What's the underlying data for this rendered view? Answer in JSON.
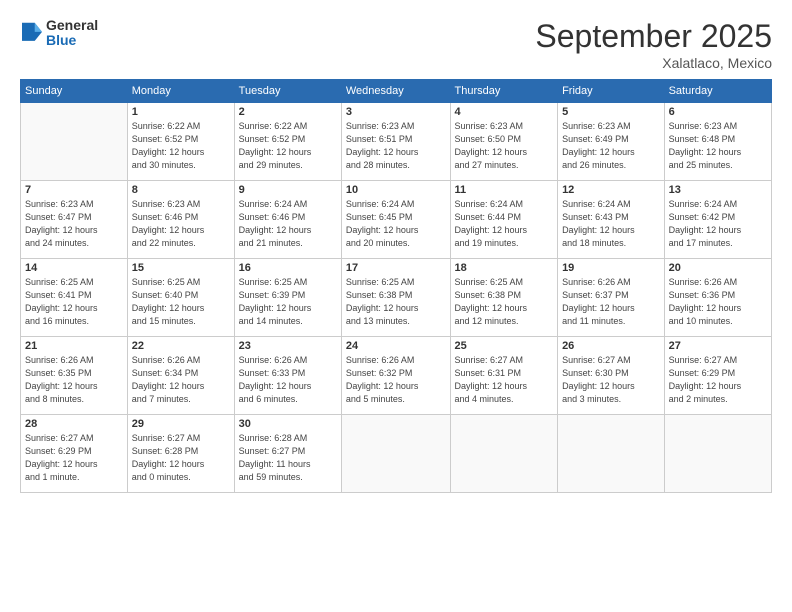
{
  "header": {
    "logo_general": "General",
    "logo_blue": "Blue",
    "month_title": "September 2025",
    "location": "Xalatlaco, Mexico"
  },
  "weekdays": [
    "Sunday",
    "Monday",
    "Tuesday",
    "Wednesday",
    "Thursday",
    "Friday",
    "Saturday"
  ],
  "weeks": [
    [
      {
        "day": "",
        "detail": ""
      },
      {
        "day": "1",
        "detail": "Sunrise: 6:22 AM\nSunset: 6:52 PM\nDaylight: 12 hours\nand 30 minutes."
      },
      {
        "day": "2",
        "detail": "Sunrise: 6:22 AM\nSunset: 6:52 PM\nDaylight: 12 hours\nand 29 minutes."
      },
      {
        "day": "3",
        "detail": "Sunrise: 6:23 AM\nSunset: 6:51 PM\nDaylight: 12 hours\nand 28 minutes."
      },
      {
        "day": "4",
        "detail": "Sunrise: 6:23 AM\nSunset: 6:50 PM\nDaylight: 12 hours\nand 27 minutes."
      },
      {
        "day": "5",
        "detail": "Sunrise: 6:23 AM\nSunset: 6:49 PM\nDaylight: 12 hours\nand 26 minutes."
      },
      {
        "day": "6",
        "detail": "Sunrise: 6:23 AM\nSunset: 6:48 PM\nDaylight: 12 hours\nand 25 minutes."
      }
    ],
    [
      {
        "day": "7",
        "detail": "Sunrise: 6:23 AM\nSunset: 6:47 PM\nDaylight: 12 hours\nand 24 minutes."
      },
      {
        "day": "8",
        "detail": "Sunrise: 6:23 AM\nSunset: 6:46 PM\nDaylight: 12 hours\nand 22 minutes."
      },
      {
        "day": "9",
        "detail": "Sunrise: 6:24 AM\nSunset: 6:46 PM\nDaylight: 12 hours\nand 21 minutes."
      },
      {
        "day": "10",
        "detail": "Sunrise: 6:24 AM\nSunset: 6:45 PM\nDaylight: 12 hours\nand 20 minutes."
      },
      {
        "day": "11",
        "detail": "Sunrise: 6:24 AM\nSunset: 6:44 PM\nDaylight: 12 hours\nand 19 minutes."
      },
      {
        "day": "12",
        "detail": "Sunrise: 6:24 AM\nSunset: 6:43 PM\nDaylight: 12 hours\nand 18 minutes."
      },
      {
        "day": "13",
        "detail": "Sunrise: 6:24 AM\nSunset: 6:42 PM\nDaylight: 12 hours\nand 17 minutes."
      }
    ],
    [
      {
        "day": "14",
        "detail": "Sunrise: 6:25 AM\nSunset: 6:41 PM\nDaylight: 12 hours\nand 16 minutes."
      },
      {
        "day": "15",
        "detail": "Sunrise: 6:25 AM\nSunset: 6:40 PM\nDaylight: 12 hours\nand 15 minutes."
      },
      {
        "day": "16",
        "detail": "Sunrise: 6:25 AM\nSunset: 6:39 PM\nDaylight: 12 hours\nand 14 minutes."
      },
      {
        "day": "17",
        "detail": "Sunrise: 6:25 AM\nSunset: 6:38 PM\nDaylight: 12 hours\nand 13 minutes."
      },
      {
        "day": "18",
        "detail": "Sunrise: 6:25 AM\nSunset: 6:38 PM\nDaylight: 12 hours\nand 12 minutes."
      },
      {
        "day": "19",
        "detail": "Sunrise: 6:26 AM\nSunset: 6:37 PM\nDaylight: 12 hours\nand 11 minutes."
      },
      {
        "day": "20",
        "detail": "Sunrise: 6:26 AM\nSunset: 6:36 PM\nDaylight: 12 hours\nand 10 minutes."
      }
    ],
    [
      {
        "day": "21",
        "detail": "Sunrise: 6:26 AM\nSunset: 6:35 PM\nDaylight: 12 hours\nand 8 minutes."
      },
      {
        "day": "22",
        "detail": "Sunrise: 6:26 AM\nSunset: 6:34 PM\nDaylight: 12 hours\nand 7 minutes."
      },
      {
        "day": "23",
        "detail": "Sunrise: 6:26 AM\nSunset: 6:33 PM\nDaylight: 12 hours\nand 6 minutes."
      },
      {
        "day": "24",
        "detail": "Sunrise: 6:26 AM\nSunset: 6:32 PM\nDaylight: 12 hours\nand 5 minutes."
      },
      {
        "day": "25",
        "detail": "Sunrise: 6:27 AM\nSunset: 6:31 PM\nDaylight: 12 hours\nand 4 minutes."
      },
      {
        "day": "26",
        "detail": "Sunrise: 6:27 AM\nSunset: 6:30 PM\nDaylight: 12 hours\nand 3 minutes."
      },
      {
        "day": "27",
        "detail": "Sunrise: 6:27 AM\nSunset: 6:29 PM\nDaylight: 12 hours\nand 2 minutes."
      }
    ],
    [
      {
        "day": "28",
        "detail": "Sunrise: 6:27 AM\nSunset: 6:29 PM\nDaylight: 12 hours\nand 1 minute."
      },
      {
        "day": "29",
        "detail": "Sunrise: 6:27 AM\nSunset: 6:28 PM\nDaylight: 12 hours\nand 0 minutes."
      },
      {
        "day": "30",
        "detail": "Sunrise: 6:28 AM\nSunset: 6:27 PM\nDaylight: 11 hours\nand 59 minutes."
      },
      {
        "day": "",
        "detail": ""
      },
      {
        "day": "",
        "detail": ""
      },
      {
        "day": "",
        "detail": ""
      },
      {
        "day": "",
        "detail": ""
      }
    ]
  ]
}
